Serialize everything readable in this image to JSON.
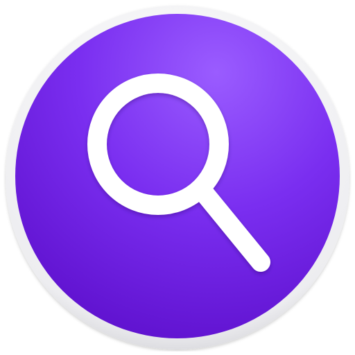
{
  "app_icon": {
    "name": "search-app-icon",
    "glyph": "magnifying-glass-icon",
    "colors": {
      "rim_light": "#f7f7f9",
      "rim_dark": "#cfcfd4",
      "disc_highlight": "#9a5cff",
      "disc_mid": "#7a2ef0",
      "disc_dark": "#5a0cc8",
      "glyph": "#ffffff"
    }
  }
}
